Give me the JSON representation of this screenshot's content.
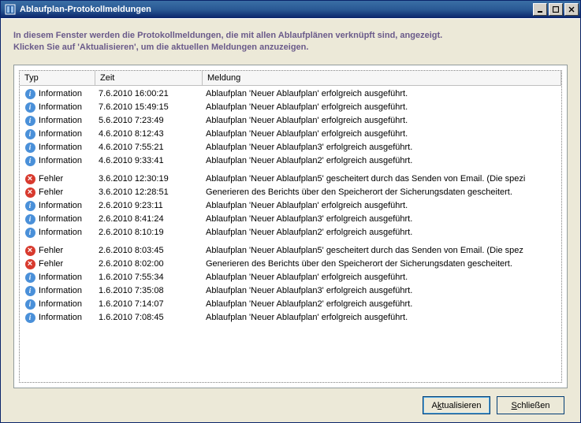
{
  "window": {
    "title": "Ablaufplan-Protokollmeldungen"
  },
  "intro": {
    "line1": "In diesem Fenster werden die Protokollmeldungen, die mit allen Ablaufplänen verknüpft sind, angezeigt.",
    "line2": "Klicken Sie auf 'Aktualisieren', um die aktuellen Meldungen anzuzeigen."
  },
  "columns": {
    "typ": "Typ",
    "zeit": "Zeit",
    "meldung": "Meldung"
  },
  "rows": [
    {
      "type": "info",
      "typ": "Information",
      "zeit": "7.6.2010  16:00:21",
      "meldung": "Ablaufplan 'Neuer Ablaufplan' erfolgreich ausgeführt."
    },
    {
      "type": "info",
      "typ": "Information",
      "zeit": "7.6.2010  15:49:15",
      "meldung": "Ablaufplan 'Neuer Ablaufplan' erfolgreich ausgeführt."
    },
    {
      "type": "info",
      "typ": "Information",
      "zeit": "5.6.2010    7:23:49",
      "meldung": "Ablaufplan 'Neuer Ablaufplan' erfolgreich ausgeführt."
    },
    {
      "type": "info",
      "typ": "Information",
      "zeit": "4.6.2010    8:12:43",
      "meldung": "Ablaufplan 'Neuer Ablaufplan' erfolgreich ausgeführt."
    },
    {
      "type": "info",
      "typ": "Information",
      "zeit": "4.6.2010    7:55:21",
      "meldung": "Ablaufplan 'Neuer Ablaufplan3' erfolgreich ausgeführt."
    },
    {
      "type": "info",
      "typ": "Information",
      "zeit": "4.6.2010    9:33:41",
      "meldung": "Ablaufplan 'Neuer Ablaufplan2' erfolgreich ausgeführt."
    },
    {
      "type": "gap"
    },
    {
      "type": "error",
      "typ": "Fehler",
      "zeit": "3.6.2010  12:30:19",
      "meldung": "Ablaufplan 'Neuer Ablaufplan5' gescheitert durch das Senden von Email. (Die spezi"
    },
    {
      "type": "error",
      "typ": "Fehler",
      "zeit": "3.6.2010  12:28:51",
      "meldung": "Generieren des Berichts über den Speicherort der Sicherungsdaten gescheitert."
    },
    {
      "type": "info",
      "typ": "Information",
      "zeit": "2.6.2010  9:23:11",
      "meldung": "Ablaufplan 'Neuer Ablaufplan' erfolgreich ausgeführt."
    },
    {
      "type": "info",
      "typ": "Information",
      "zeit": "2.6.2010  8:41:24",
      "meldung": "Ablaufplan 'Neuer Ablaufplan3' erfolgreich ausgeführt."
    },
    {
      "type": "info",
      "typ": "Information",
      "zeit": "2.6.2010  8:10:19",
      "meldung": "Ablaufplan 'Neuer Ablaufplan2' erfolgreich ausgeführt."
    },
    {
      "type": "gap"
    },
    {
      "type": "error",
      "typ": "Fehler",
      "zeit": "2.6.2010 8:03:45",
      "meldung": "Ablaufplan 'Neuer Ablaufplan5' gescheitert durch das Senden von Email. (Die spez"
    },
    {
      "type": "error",
      "typ": "Fehler",
      "zeit": "2.6.2010 8:02:00",
      "meldung": "Generieren des Berichts über den Speicherort der Sicherungsdaten gescheitert."
    },
    {
      "type": "info",
      "typ": "Information",
      "zeit": "1.6.2010  7:55:34",
      "meldung": "Ablaufplan 'Neuer Ablaufplan' erfolgreich ausgeführt."
    },
    {
      "type": "info",
      "typ": "Information",
      "zeit": "1.6.2010  7:35:08",
      "meldung": "Ablaufplan 'Neuer Ablaufplan3' erfolgreich ausgeführt."
    },
    {
      "type": "info",
      "typ": "Information",
      "zeit": "1.6.2010  7:14:07",
      "meldung": "Ablaufplan 'Neuer Ablaufplan2' erfolgreich ausgeführt."
    },
    {
      "type": "info",
      "typ": "Information",
      "zeit": "1.6.2010  7:08:45",
      "meldung": "Ablaufplan 'Neuer Ablaufplan' erfolgreich ausgeführt."
    }
  ],
  "buttons": {
    "refresh_pre": "A",
    "refresh_u": "k",
    "refresh_post": "tualisieren",
    "close_pre": "",
    "close_u": "S",
    "close_post": "chließen"
  }
}
